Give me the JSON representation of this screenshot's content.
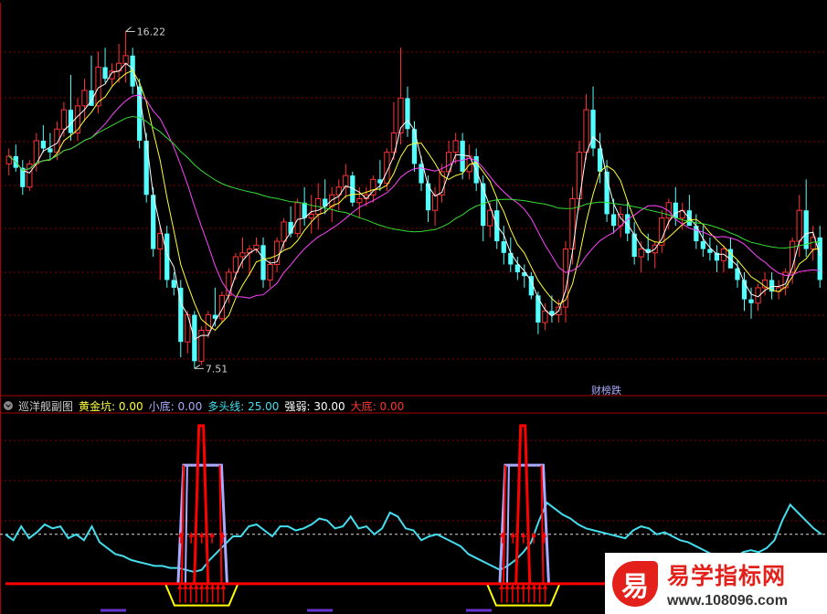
{
  "colors": {
    "bg": "#000000",
    "up": "#ff3333",
    "down": "#54ffff",
    "ma_white": "#ffffff",
    "ma_yellow": "#ffff33",
    "ma_magenta": "#ff44ff",
    "ma_green": "#33dd33",
    "grid": "#880000",
    "osc": "#44ddee",
    "golden": "#ffff00",
    "small": "#aaaaff",
    "big": "#ff0000",
    "arrow": "#ff0000"
  },
  "chart_data": [
    {
      "type": "candlestick",
      "max_label": "16.22",
      "min_label": "7.51",
      "event_label": "财榜跌",
      "ylim": [
        7.0,
        16.8
      ],
      "candles": [
        [
          12.8,
          13.2,
          12.5,
          13.0
        ],
        [
          13.0,
          13.3,
          12.6,
          12.7
        ],
        [
          12.7,
          12.9,
          12.0,
          12.2
        ],
        [
          12.2,
          12.9,
          12.1,
          12.8
        ],
        [
          12.8,
          13.6,
          12.6,
          13.4
        ],
        [
          13.4,
          13.8,
          13.1,
          13.2
        ],
        [
          13.2,
          13.6,
          12.9,
          13.1
        ],
        [
          13.1,
          13.9,
          12.9,
          13.7
        ],
        [
          13.7,
          14.4,
          13.5,
          14.2
        ],
        [
          14.2,
          15.1,
          13.4,
          13.6
        ],
        [
          13.6,
          14.5,
          13.4,
          14.3
        ],
        [
          14.3,
          15.0,
          13.9,
          14.7
        ],
        [
          14.7,
          15.6,
          14.3,
          14.3
        ],
        [
          14.3,
          15.7,
          14.1,
          15.3
        ],
        [
          15.3,
          15.8,
          14.9,
          15.0
        ],
        [
          15.0,
          15.4,
          14.8,
          15.2
        ],
        [
          15.2,
          15.9,
          14.9,
          15.4
        ],
        [
          15.4,
          16.22,
          14.9,
          15.6
        ],
        [
          15.6,
          15.8,
          14.6,
          14.8
        ],
        [
          14.8,
          15.0,
          13.2,
          13.4
        ],
        [
          13.4,
          13.6,
          11.8,
          12.0
        ],
        [
          12.0,
          12.2,
          10.4,
          10.6
        ],
        [
          10.6,
          11.2,
          9.8,
          11.0
        ],
        [
          11.0,
          11.2,
          9.6,
          9.8
        ],
        [
          9.8,
          10.0,
          9.4,
          9.6
        ],
        [
          9.6,
          9.8,
          7.8,
          8.2
        ],
        [
          8.2,
          9.0,
          7.9,
          8.9
        ],
        [
          8.9,
          9.0,
          7.51,
          7.7
        ],
        [
          7.7,
          8.6,
          7.6,
          8.5
        ],
        [
          8.5,
          9.0,
          8.3,
          8.9
        ],
        [
          8.9,
          9.6,
          8.6,
          8.8
        ],
        [
          8.8,
          9.5,
          8.7,
          9.4
        ],
        [
          9.4,
          10.1,
          9.2,
          10.0
        ],
        [
          10.0,
          10.5,
          9.8,
          10.4
        ],
        [
          10.4,
          10.9,
          10.1,
          10.5
        ],
        [
          10.5,
          10.7,
          9.9,
          10.6
        ],
        [
          10.6,
          10.9,
          10.5,
          10.7
        ],
        [
          10.7,
          10.9,
          9.6,
          9.8
        ],
        [
          9.8,
          10.3,
          9.6,
          10.2
        ],
        [
          10.2,
          10.9,
          10.0,
          10.8
        ],
        [
          10.8,
          11.4,
          10.6,
          11.3
        ],
        [
          11.3,
          11.7,
          10.9,
          11.0
        ],
        [
          11.0,
          11.9,
          10.9,
          11.8
        ],
        [
          11.8,
          12.2,
          11.2,
          11.4
        ],
        [
          11.4,
          12.0,
          11.0,
          11.5
        ],
        [
          11.5,
          12.3,
          11.1,
          11.9
        ],
        [
          11.9,
          12.4,
          11.5,
          11.7
        ],
        [
          11.7,
          12.2,
          11.3,
          12.0
        ],
        [
          12.0,
          12.4,
          11.6,
          12.2
        ],
        [
          12.2,
          12.8,
          11.9,
          12.5
        ],
        [
          12.5,
          12.6,
          11.7,
          11.8
        ],
        [
          11.8,
          12.2,
          11.4,
          11.9
        ],
        [
          11.9,
          12.2,
          11.7,
          12.0
        ],
        [
          12.0,
          12.5,
          11.8,
          12.4
        ],
        [
          12.4,
          12.9,
          12.1,
          12.3
        ],
        [
          12.3,
          13.2,
          12.1,
          13.1
        ],
        [
          13.1,
          14.4,
          12.9,
          13.6
        ],
        [
          13.6,
          15.8,
          13.3,
          14.5
        ],
        [
          14.5,
          14.8,
          13.5,
          13.7
        ],
        [
          13.7,
          13.9,
          12.6,
          12.8
        ],
        [
          12.8,
          13.0,
          12.1,
          12.3
        ],
        [
          12.3,
          12.5,
          11.3,
          11.6
        ],
        [
          11.6,
          12.2,
          11.2,
          12.0
        ],
        [
          12.0,
          12.8,
          11.8,
          12.6
        ],
        [
          12.6,
          13.4,
          12.5,
          13.1
        ],
        [
          13.1,
          13.6,
          12.8,
          13.4
        ],
        [
          13.4,
          13.6,
          12.4,
          12.6
        ],
        [
          12.6,
          13.3,
          12.4,
          13.0
        ],
        [
          13.0,
          13.2,
          12.1,
          12.3
        ],
        [
          12.3,
          12.5,
          10.8,
          11.2
        ],
        [
          11.2,
          11.8,
          10.9,
          11.6
        ],
        [
          11.6,
          11.9,
          10.6,
          10.8
        ],
        [
          10.8,
          11.2,
          10.2,
          10.5
        ],
        [
          10.5,
          10.9,
          10.0,
          10.2
        ],
        [
          10.2,
          10.4,
          9.8,
          10.0
        ],
        [
          10.0,
          10.2,
          9.6,
          9.9
        ],
        [
          9.9,
          10.0,
          9.3,
          9.4
        ],
        [
          9.4,
          9.5,
          8.4,
          8.7
        ],
        [
          8.7,
          9.2,
          8.5,
          9.0
        ],
        [
          9.0,
          9.4,
          8.7,
          8.9
        ],
        [
          8.9,
          9.3,
          8.7,
          9.1
        ],
        [
          9.1,
          10.8,
          8.7,
          10.6
        ],
        [
          10.6,
          12.2,
          10.2,
          11.9
        ],
        [
          11.9,
          13.4,
          11.6,
          13.1
        ],
        [
          13.1,
          14.6,
          12.9,
          14.2
        ],
        [
          14.2,
          14.8,
          13.0,
          13.2
        ],
        [
          13.2,
          13.6,
          12.3,
          12.6
        ],
        [
          12.6,
          12.9,
          11.3,
          11.5
        ],
        [
          11.5,
          11.9,
          11.0,
          11.2
        ],
        [
          11.2,
          11.7,
          10.9,
          11.5
        ],
        [
          11.5,
          11.8,
          10.8,
          11.0
        ],
        [
          11.0,
          11.3,
          10.2,
          10.4
        ],
        [
          10.4,
          10.8,
          10.0,
          10.6
        ],
        [
          10.6,
          11.0,
          10.3,
          10.5
        ],
        [
          10.5,
          10.8,
          10.1,
          10.7
        ],
        [
          10.7,
          11.6,
          10.5,
          11.4
        ],
        [
          11.4,
          11.9,
          11.1,
          11.8
        ],
        [
          11.8,
          12.2,
          11.2,
          11.4
        ],
        [
          11.4,
          11.8,
          11.1,
          11.6
        ],
        [
          11.6,
          12.0,
          11.3,
          11.2
        ],
        [
          11.2,
          11.5,
          10.6,
          10.8
        ],
        [
          10.8,
          11.2,
          10.4,
          10.6
        ],
        [
          10.6,
          10.9,
          10.3,
          10.5
        ],
        [
          10.5,
          10.7,
          10.0,
          10.3
        ],
        [
          10.3,
          10.7,
          10.0,
          10.6
        ],
        [
          10.6,
          10.9,
          10.2,
          10.1
        ],
        [
          10.1,
          10.3,
          9.6,
          9.8
        ],
        [
          9.8,
          10.0,
          9.0,
          9.3
        ],
        [
          9.3,
          9.6,
          8.8,
          9.2
        ],
        [
          9.2,
          9.7,
          9.0,
          9.6
        ],
        [
          9.6,
          10.0,
          9.4,
          9.8
        ],
        [
          9.8,
          10.0,
          9.3,
          9.5
        ],
        [
          9.5,
          9.8,
          9.3,
          9.6
        ],
        [
          9.6,
          10.1,
          9.4,
          10.0
        ],
        [
          10.0,
          10.9,
          9.7,
          10.8
        ],
        [
          10.8,
          12.0,
          10.4,
          11.6
        ],
        [
          11.6,
          12.4,
          10.4,
          10.6
        ],
        [
          10.6,
          11.2,
          10.3,
          10.9
        ],
        [
          10.9,
          11.2,
          9.6,
          9.8
        ]
      ]
    },
    {
      "type": "line",
      "indicator_name": "巡洋舰副图",
      "legend": [
        {
          "name": "黄金坑",
          "value": "0.00"
        },
        {
          "name": "小底",
          "value": "0.00"
        },
        {
          "name": "多头线",
          "value": "25.00"
        },
        {
          "name": "强弱",
          "value": "30.00"
        },
        {
          "name": "大底",
          "value": "0.00"
        }
      ],
      "reference_level": 25,
      "ylim": [
        -13,
        85
      ],
      "osc_values": [
        25,
        22,
        29,
        23,
        26,
        30,
        28,
        29,
        23,
        25,
        22,
        29,
        21,
        18,
        15,
        14,
        12,
        11,
        10,
        9,
        9,
        8,
        8,
        7,
        6,
        7,
        12,
        16,
        20,
        24,
        24,
        29,
        30,
        27,
        24,
        29,
        29,
        27,
        28,
        30,
        33,
        32,
        28,
        29,
        34,
        28,
        29,
        25,
        28,
        36,
        34,
        28,
        27,
        22,
        24,
        25,
        23,
        21,
        19,
        15,
        13,
        11,
        9,
        7,
        9,
        12,
        16,
        21,
        32,
        41,
        38,
        35,
        33,
        30,
        28,
        27,
        26,
        25,
        24,
        23,
        27,
        29,
        28,
        25,
        26,
        24,
        22,
        21,
        19,
        17,
        15,
        13,
        11,
        13,
        16,
        17,
        16,
        18,
        22,
        32,
        40,
        36,
        32,
        28,
        25
      ]
    }
  ],
  "watermark": {
    "logo_char": "易",
    "name": "易学指标网",
    "url": "www.108096.com"
  }
}
